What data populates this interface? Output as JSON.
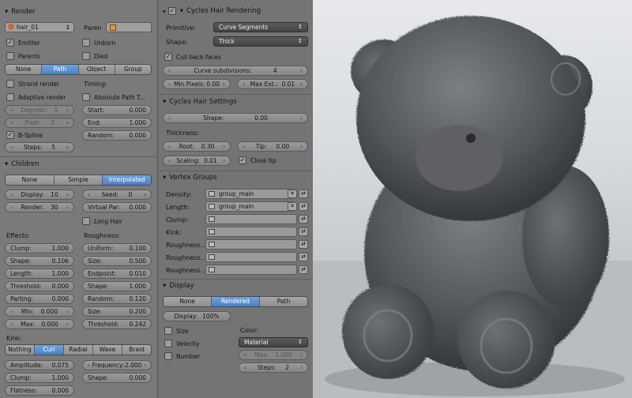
{
  "left": {
    "render_header": "Render",
    "material_name": "hair_01",
    "parent_label": "Paren",
    "emitter": "Emitter",
    "unborn": "Unborn",
    "parents": "Parents",
    "died": "Died",
    "render_tabs": [
      "None",
      "Path",
      "Object",
      "Group"
    ],
    "render_tab_active": 1,
    "strand_render": "Strand render",
    "timing": "Timing:",
    "adaptive_render": "Adaptive render",
    "absolute_path": "Absolute Path T...",
    "degrees_label": "Degrees:",
    "degrees_value": "5",
    "start_label": "Start:",
    "start_value": "0.000",
    "pixel_label": "Pixel:",
    "pixel_value": "3",
    "end_label": "End:",
    "end_value": "1.000",
    "bspline": "B-Spline",
    "random_label": "Random:",
    "random_value": "0.000",
    "steps_label": "Steps:",
    "steps_value": "5",
    "children_header": "Children",
    "children_tabs": [
      "None",
      "Simple",
      "Interpolated"
    ],
    "children_tab_active": 2,
    "display_label": "Display:",
    "display_value": "10",
    "seed_label": "Seed:",
    "seed_value": "0",
    "render_label": "Render:",
    "render_value": "30",
    "virtual_par_label": "Virtual Par:",
    "virtual_par_value": "0.000",
    "long_hair": "Long Hair",
    "effects": "Effects:",
    "roughness": "Roughness:",
    "clump_label": "Clump:",
    "clump_value": "1.000",
    "uniform_label": "Uniform:",
    "uniform_value": "0.100",
    "shape_label": "Shape:",
    "shape_value": "0.106",
    "size_label": "Size:",
    "size_value": "0.500",
    "length_label": "Length:",
    "length_value": "1.000",
    "endpoint_label": "Endpoint:",
    "endpoint_value": "0.010",
    "threshold_label": "Threshold:",
    "threshold_value": "0.000",
    "shape2_label": "Shape:",
    "shape2_value": "1.000",
    "parting_label": "Parting:",
    "parting_value": "0.000",
    "random2_label": "Random:",
    "random2_value": "0.120",
    "min_label": "Min:",
    "min_value": "0.000",
    "size2_label": "Size:",
    "size2_value": "0.200",
    "max_label": "Max:",
    "max_value": "0.000",
    "threshold2_label": "Threshold:",
    "threshold2_value": "0.242",
    "kink": "Kink:",
    "kink_tabs": [
      "Nothing",
      "Curl",
      "Radial",
      "Wave",
      "Braid"
    ],
    "kink_tab_active": 1,
    "amplitude_label": "Amplitude:",
    "amplitude_value": "0.075",
    "frequency_label": "Frequency:",
    "frequency_value": "2.000",
    "kclump_label": "Clump:",
    "kclump_value": "1.000",
    "kshape_label": "Shape:",
    "kshape_value": "0.000",
    "flatness_label": "Flatness:",
    "flatness_value": "0.000"
  },
  "mid": {
    "cycles_header": "Cycles Hair Rendering",
    "primitive_label": "Primitive:",
    "primitive_value": "Curve Segments",
    "shape_label": "Shape:",
    "shape_value": "Thick",
    "cull_backface": "Cull back-faces",
    "curve_subdiv_label": "Curve subdivisions:",
    "curve_subdiv_value": "4",
    "min_pixels_label": "Min Pixels:",
    "min_pixels_value": "0.00",
    "max_ext_label": "Max Ext.:",
    "max_ext_value": "0.01",
    "settings_header": "Cycles Hair Settings",
    "hshape_label": "Shape:",
    "hshape_value": "0.00",
    "thickness": "Thickness:",
    "root_label": "Root:",
    "root_value": "0.30",
    "tip_label": "Tip:",
    "tip_value": "0.00",
    "scaling_label": "Scaling:",
    "scaling_value": "0.01",
    "close_tip": "Close tip",
    "vertex_header": "Vertex Groups",
    "vgroups": [
      {
        "label": "Density:",
        "value": "group_main"
      },
      {
        "label": "Length:",
        "value": "group_main"
      },
      {
        "label": "Clump:",
        "value": ""
      },
      {
        "label": "Kink:",
        "value": ""
      },
      {
        "label": "Roughness...",
        "value": ""
      },
      {
        "label": "Roughness...",
        "value": ""
      },
      {
        "label": "Roughness...",
        "value": ""
      }
    ],
    "display_header": "Display",
    "display_tabs": [
      "None",
      "Rendered",
      "Path"
    ],
    "display_tab_active": 1,
    "display_label": "Display:",
    "display_value": "100%",
    "size": "Size",
    "velocity": "Velocity",
    "number": "Number",
    "color_label": "Color:",
    "color_value": "Material",
    "cmax_label": "Max:",
    "cmax_value": "1.000",
    "steps_label": "Steps:",
    "steps_value": "2"
  },
  "colors": {
    "accent_blue": "#5a8fd4",
    "panel_gray": "#7a7a7a"
  },
  "icons": [
    "particle-settings-icon",
    "mesh-icon",
    "vertex-group-icon",
    "clear-icon",
    "lock-icon"
  ]
}
